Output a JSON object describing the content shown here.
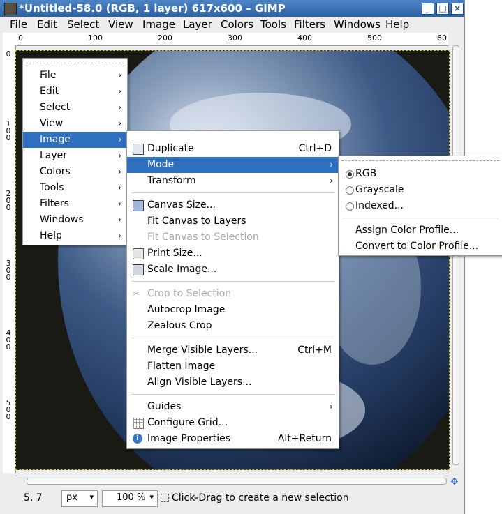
{
  "window": {
    "title": "*Untitled-58.0 (RGB, 1 layer) 617x600 – GIMP",
    "buttons": {
      "minimize": "_",
      "maximize": "□",
      "close": "×"
    }
  },
  "menubar": [
    "File",
    "Edit",
    "Select",
    "View",
    "Image",
    "Layer",
    "Colors",
    "Tools",
    "Filters",
    "Windows",
    "Help"
  ],
  "rulers": {
    "horizontal": [
      "0",
      "100",
      "200",
      "300",
      "400",
      "500",
      "60"
    ],
    "vertical": [
      "0",
      "1\n0\n0",
      "2\n0\n0",
      "3\n0\n0",
      "4\n0\n0",
      "5\n0\n0"
    ]
  },
  "main_menu": {
    "items": [
      "File",
      "Edit",
      "Select",
      "View",
      "Image",
      "Layer",
      "Colors",
      "Tools",
      "Filters",
      "Windows",
      "Help"
    ],
    "highlighted": "Image"
  },
  "image_menu": {
    "duplicate": {
      "label": "Duplicate",
      "accel": "Ctrl+D"
    },
    "mode": "Mode",
    "transform": "Transform",
    "canvas_size": "Canvas Size...",
    "fit_canvas_layers": "Fit Canvas to Layers",
    "fit_canvas_selection": "Fit Canvas to Selection",
    "print_size": "Print Size...",
    "scale_image": "Scale Image...",
    "crop_selection": "Crop to Selection",
    "autocrop": "Autocrop Image",
    "zealous_crop": "Zealous Crop",
    "merge_visible": {
      "label": "Merge Visible Layers...",
      "accel": "Ctrl+M"
    },
    "flatten": "Flatten Image",
    "align_visible": "Align Visible Layers...",
    "guides": "Guides",
    "configure_grid": "Configure Grid...",
    "image_properties": {
      "label": "Image Properties",
      "accel": "Alt+Return"
    }
  },
  "mode_menu": {
    "rgb": "RGB",
    "grayscale": "Grayscale",
    "indexed": "Indexed...",
    "assign_profile": "Assign Color Profile...",
    "convert_profile": "Convert to Color Profile...",
    "selected": "RGB"
  },
  "status": {
    "coords": "5, 7",
    "unit": "px",
    "zoom": "100 %",
    "message": "Click-Drag to create a new selection"
  },
  "colors": {
    "highlight": "#2f6fc0",
    "titlebar": "#3a72b6"
  }
}
